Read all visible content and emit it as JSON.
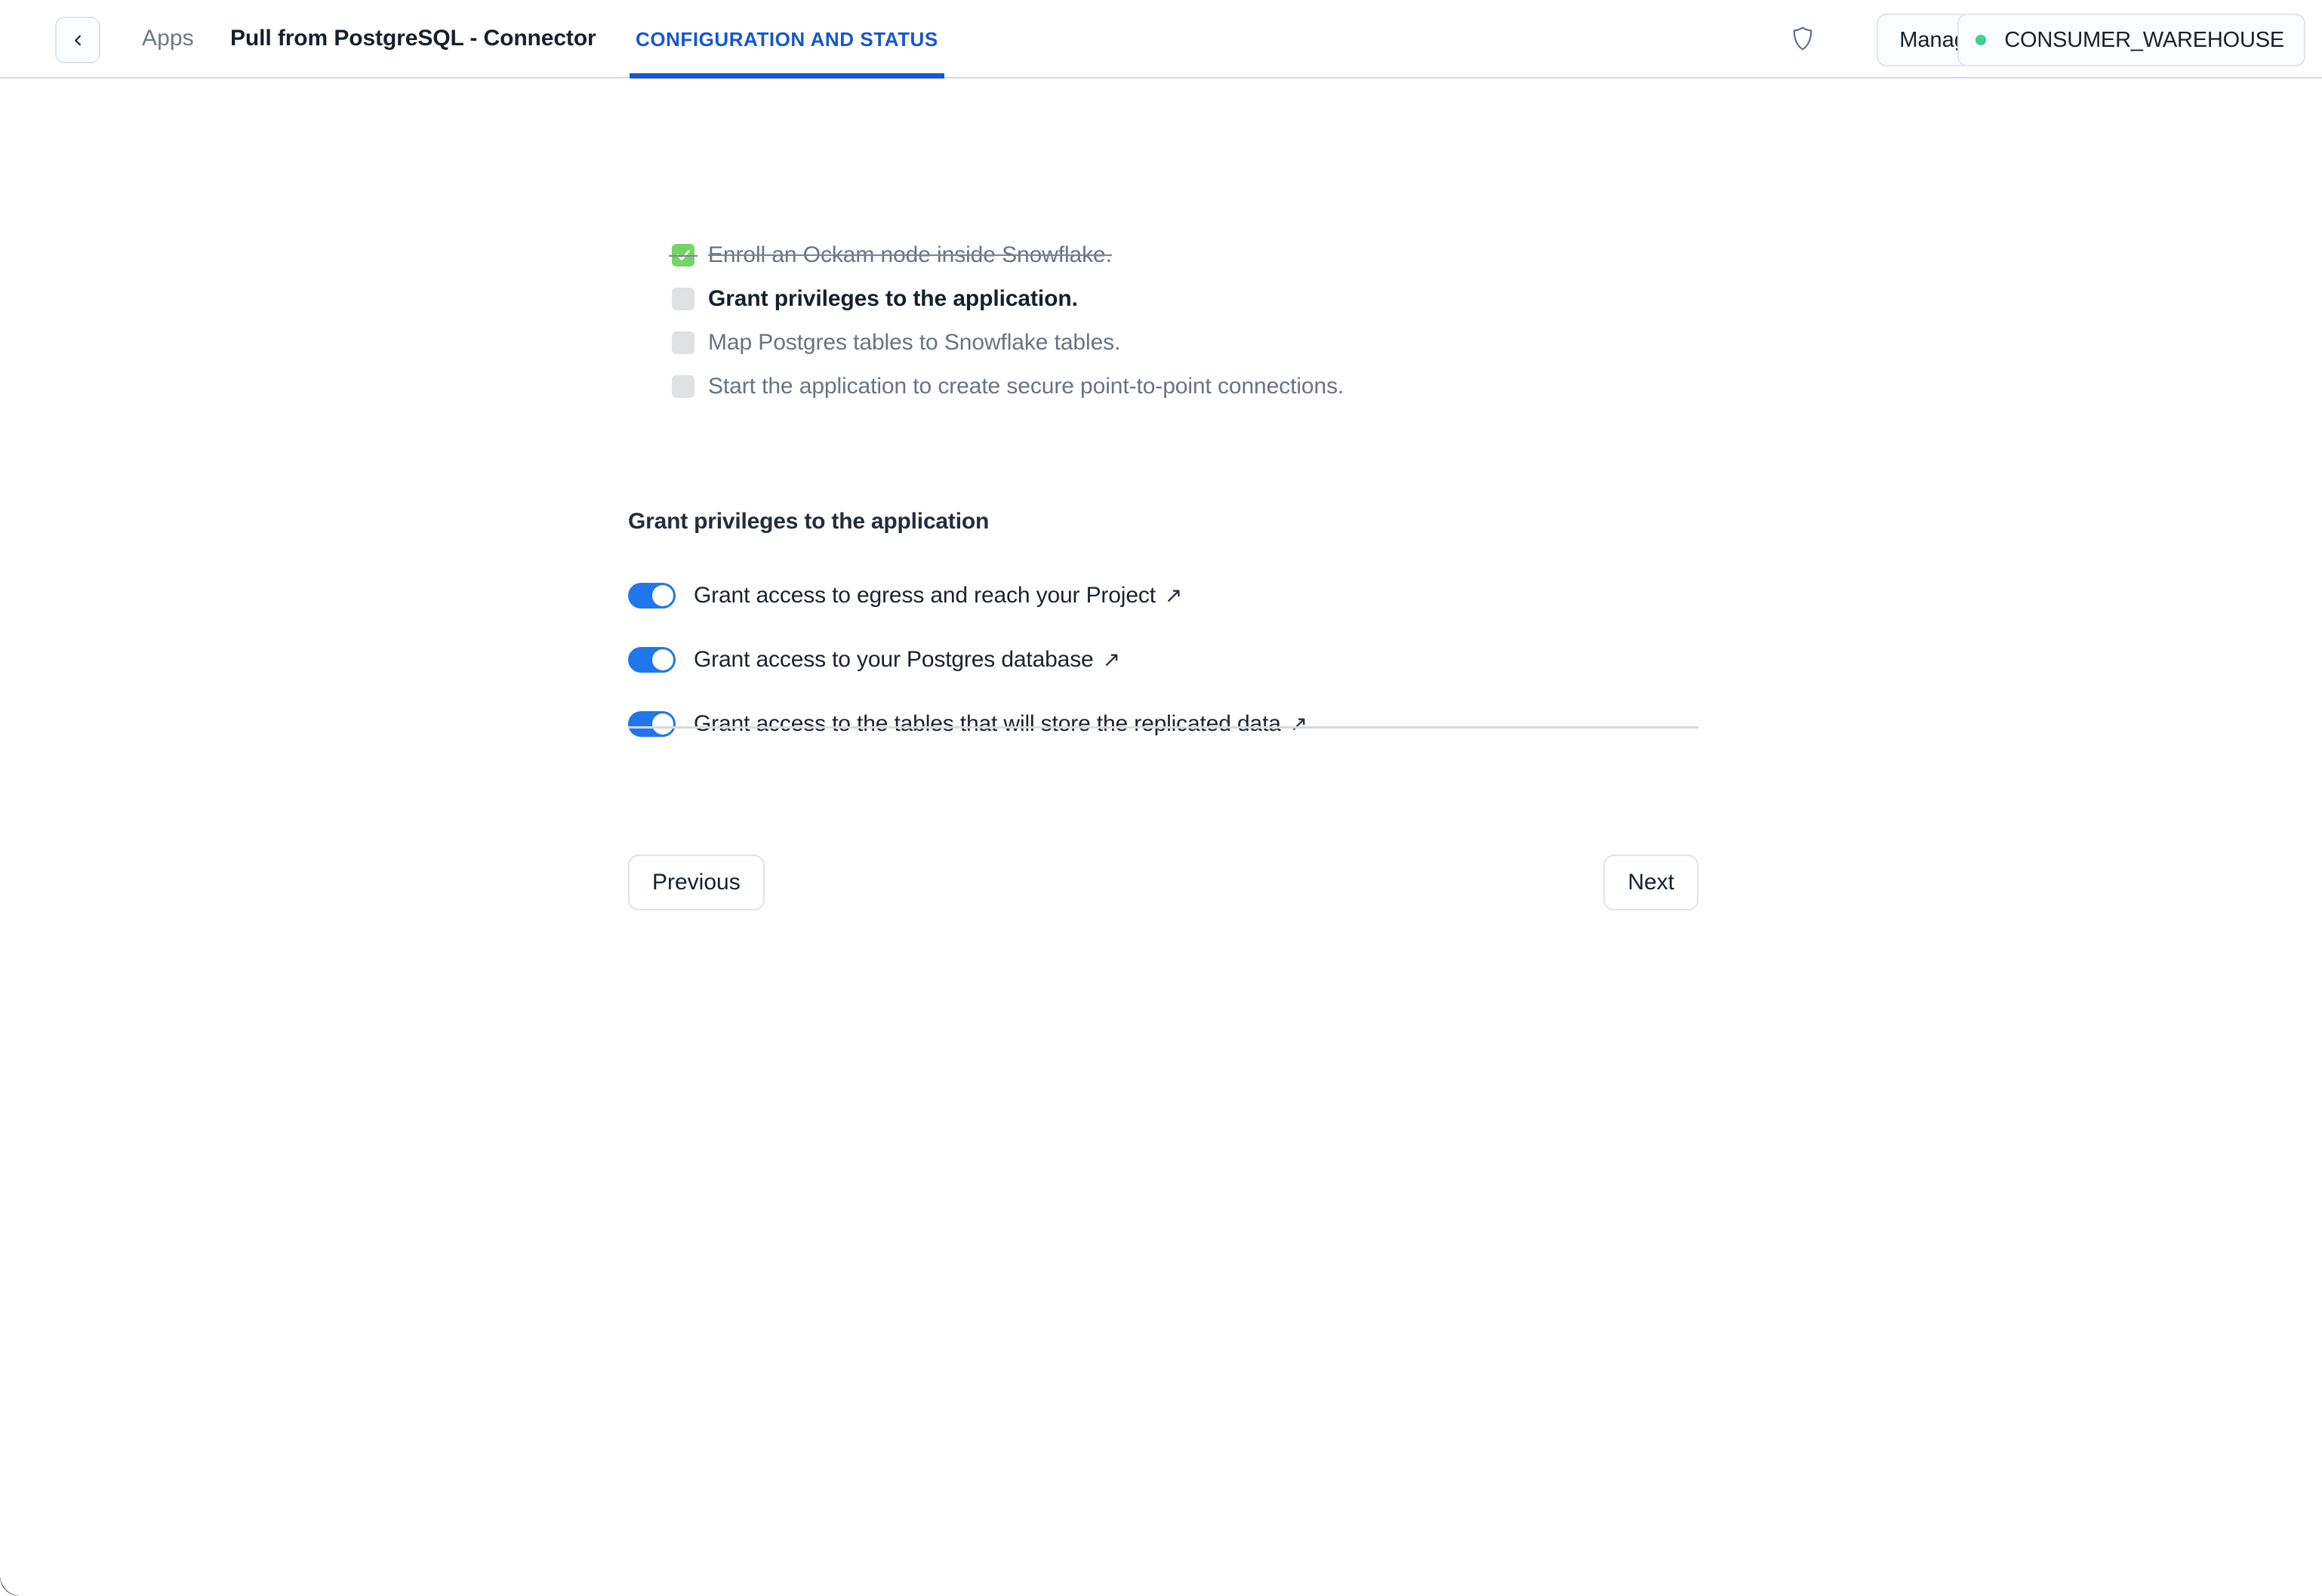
{
  "header": {
    "back_icon": "chevron-left-icon",
    "breadcrumb_apps": "Apps",
    "app_title": "Pull from PostgreSQL - Connector",
    "tab_label": "CONFIGURATION AND STATUS",
    "shield_icon": "shield-icon",
    "manage_access_label": "Manage Access",
    "warehouse_name": "CONSUMER_WAREHOUSE",
    "warehouse_status_dot_color": "#3ecf94",
    "accent_color": "#1557d0"
  },
  "checklist": {
    "items": [
      {
        "label": "Enroll an Ockam node inside Snowflake.",
        "state": "done"
      },
      {
        "label": "Grant privileges to the application.",
        "state": "current"
      },
      {
        "label": "Map Postgres tables to Snowflake tables.",
        "state": "todo"
      },
      {
        "label": "Start the application to create secure point-to-point connections.",
        "state": "todo"
      }
    ]
  },
  "main": {
    "section_heading": "Grant privileges to the application",
    "toggles": [
      {
        "label": "Grant access to egress and reach your Project",
        "link_icon": "↗",
        "on": true
      },
      {
        "label": "Grant access to your Postgres database",
        "link_icon": "↗",
        "on": true
      },
      {
        "label": "Grant access to the tables that will store the replicated data",
        "link_icon": "↗",
        "on": true
      }
    ],
    "toggle_on_color": "#2176ec"
  },
  "footer": {
    "previous_label": "Previous",
    "next_label": "Next"
  }
}
